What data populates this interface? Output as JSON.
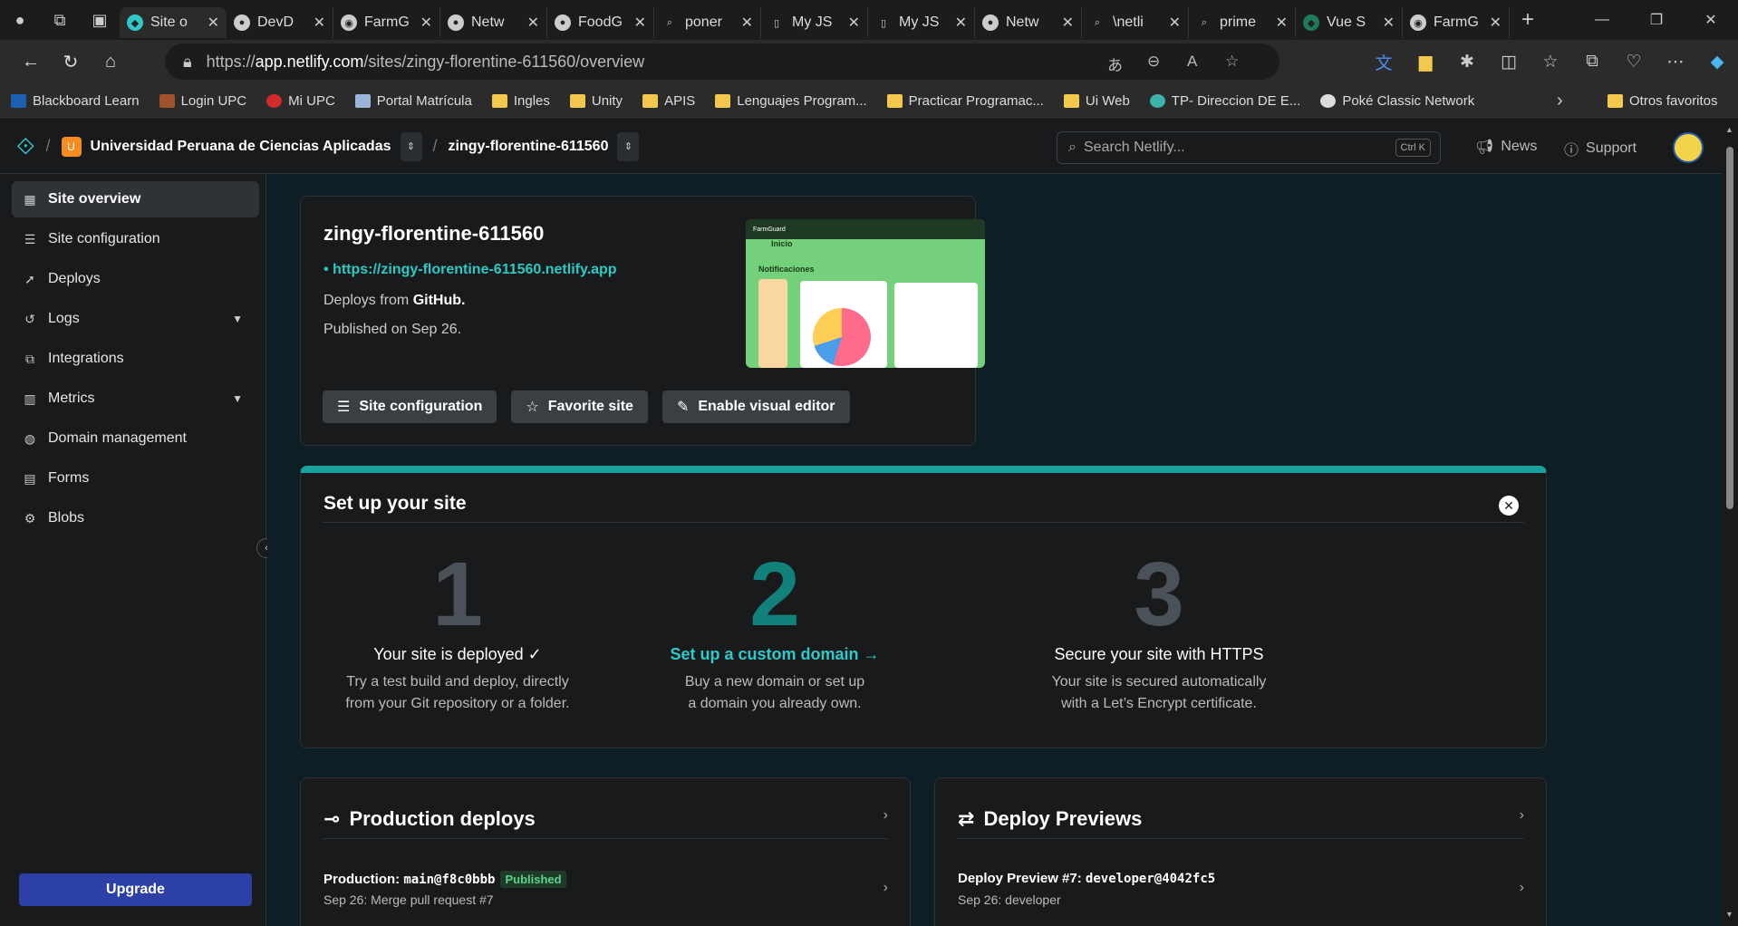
{
  "browser": {
    "tabs": [
      {
        "label": "Site o",
        "icon": "netlify-icon",
        "active": true
      },
      {
        "label": "DevD",
        "icon": "github-icon"
      },
      {
        "label": "FarmG",
        "icon": "farmguard-icon"
      },
      {
        "label": "Netw",
        "icon": "github-icon"
      },
      {
        "label": "FoodG",
        "icon": "github-icon"
      },
      {
        "label": "poner",
        "icon": "search-icon"
      },
      {
        "label": "My JS",
        "icon": "file-icon"
      },
      {
        "label": "My JS",
        "icon": "file-icon"
      },
      {
        "label": "Netw",
        "icon": "github-icon"
      },
      {
        "label": "\\netli",
        "icon": "search-icon"
      },
      {
        "label": "prime",
        "icon": "search-icon"
      },
      {
        "label": "Vue S",
        "icon": "shield-icon"
      },
      {
        "label": "FarmG",
        "icon": "farmguard-icon"
      }
    ],
    "address": {
      "prefix": "https://",
      "host": "app.netlify.com",
      "path": "/sites/zingy-florentine-611560/overview"
    },
    "bookmarks": [
      "Blackboard Learn",
      "Login UPC",
      "Mi UPC",
      "Portal Matrícula",
      "Ingles",
      "Unity",
      "APIS",
      "Lenguajes Program...",
      "Practicar Programac...",
      "Ui Web",
      "TP- Direccion DE E...",
      "Poké Classic Network"
    ],
    "other_bookmarks": "Otros favoritos"
  },
  "topbar": {
    "team_initial": "U",
    "team": "Universidad Peruana de Ciencias Aplicadas",
    "site": "zingy-florentine-611560",
    "search_placeholder": "Search Netlify...",
    "search_kbd": "Ctrl K",
    "news": "News",
    "support": "Support"
  },
  "sidebar": {
    "items": [
      {
        "label": "Site overview",
        "icon": "grid-icon",
        "active": true
      },
      {
        "label": "Site configuration",
        "icon": "settings-icon"
      },
      {
        "label": "Deploys",
        "icon": "rocket-icon"
      },
      {
        "label": "Logs",
        "icon": "logs-icon",
        "expandable": true
      },
      {
        "label": "Integrations",
        "icon": "integrations-icon"
      },
      {
        "label": "Metrics",
        "icon": "metrics-icon",
        "expandable": true
      },
      {
        "label": "Domain management",
        "icon": "globe-icon"
      },
      {
        "label": "Forms",
        "icon": "forms-icon"
      },
      {
        "label": "Blobs",
        "icon": "blobs-icon"
      }
    ],
    "upgrade": "Upgrade"
  },
  "overview": {
    "title": "zingy-florentine-611560",
    "url": "https://zingy-florentine-611560.netlify.app",
    "deploys_from_prefix": "Deploys from",
    "deploys_from": "GitHub.",
    "published": "Published on Sep 26.",
    "buttons": {
      "site_config": "Site configuration",
      "favorite": "Favorite site",
      "visual_editor": "Enable visual editor"
    },
    "thumb": {
      "heading": "Inicio",
      "section": "Notificaciones",
      "brand": "FarmGuard"
    }
  },
  "setup": {
    "title": "Set up your site",
    "steps": [
      {
        "num": "1",
        "title": "Your site is deployed ✓",
        "desc1": "Try a test build and deploy, directly",
        "desc2": "from your Git repository or a folder."
      },
      {
        "num": "2",
        "title": "Set up a custom domain →",
        "desc1": "Buy a new domain or set up",
        "desc2": "a domain you already own."
      },
      {
        "num": "3",
        "title": "Secure your site with HTTPS",
        "desc1": "Your site is secured automatically",
        "desc2": "with a Let’s Encrypt certificate."
      }
    ]
  },
  "production": {
    "title": "Production deploys",
    "entry_prefix": "Production:",
    "entry_ref": "main@f8c0bbb",
    "badge": "Published",
    "sub": "Sep 26: Merge pull request #7"
  },
  "previews": {
    "title": "Deploy Previews",
    "entry_prefix": "Deploy Preview #7:",
    "entry_ref": "developer@4042fc5",
    "sub": "Sep 26: developer"
  }
}
